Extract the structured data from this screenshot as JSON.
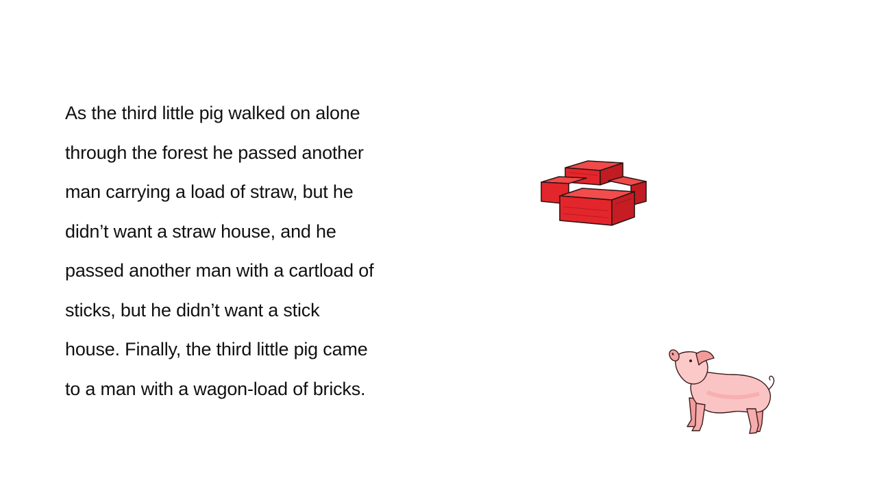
{
  "story": {
    "lines": [
      "As the third little pig walked on alone",
      "through the forest he passed another",
      "man carrying a load of straw, but he",
      "didn’t want a straw house, and he",
      "passed another man with a cartload of",
      "sticks, but he didn’t want a stick",
      "house.  Finally, the third little pig came",
      "to a man with a wagon-load of bricks."
    ]
  },
  "illustrations": {
    "bricks": {
      "icon": "bricks-icon",
      "color": "#e8262b"
    },
    "pig": {
      "icon": "pig-icon",
      "color": "#f7b3b3"
    }
  }
}
